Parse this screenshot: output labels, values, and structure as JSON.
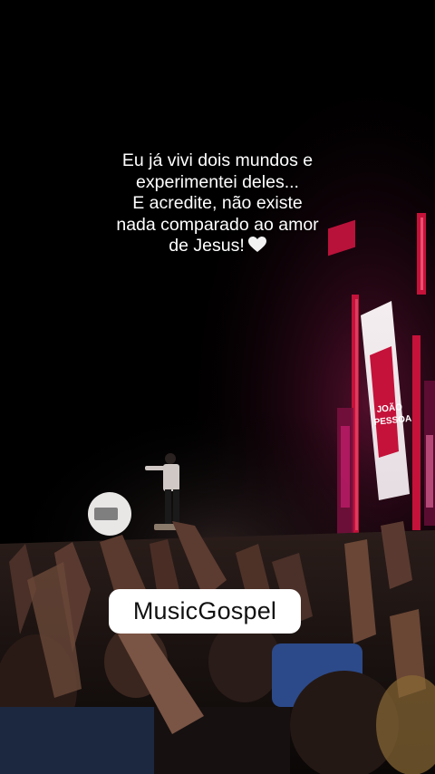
{
  "caption": {
    "lines": [
      "Eu já vivi dois mundos e",
      "experimentei deles...",
      "E acredite, não existe",
      "nada comparado ao amor",
      "de Jesus!"
    ],
    "emoji": "white-heart-icon"
  },
  "screen": {
    "title_top": "JOÃO",
    "title_bottom": "PESSOA"
  },
  "tag": {
    "label": "MusicGospel"
  },
  "colors": {
    "background": "#000000",
    "stage_red": "#c4123a",
    "stage_magenta": "#d8207a",
    "tag_bg": "#ffffff"
  }
}
